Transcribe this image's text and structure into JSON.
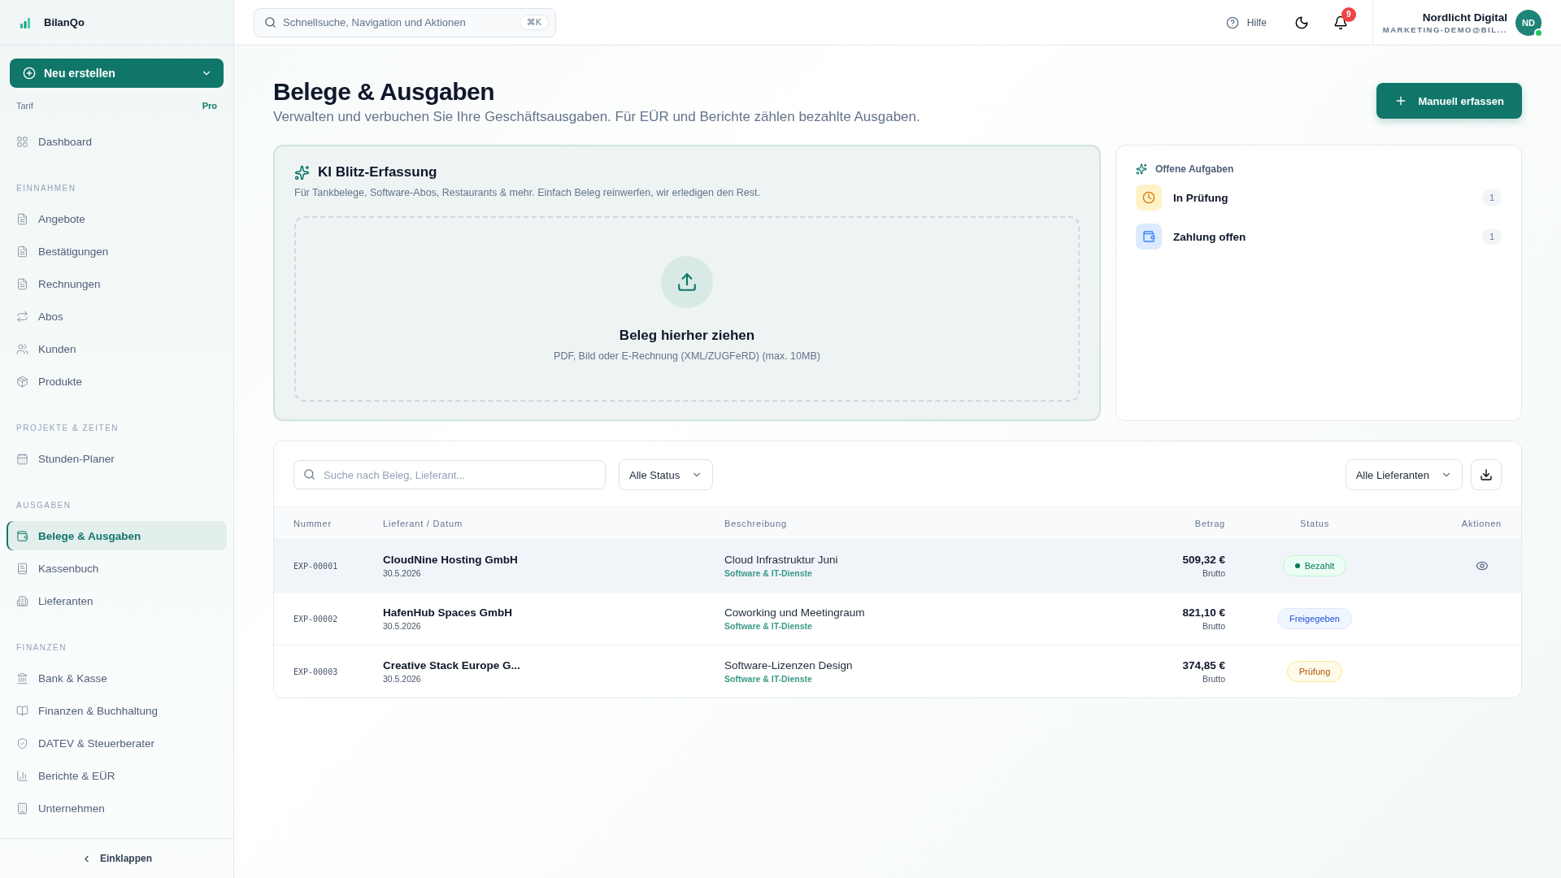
{
  "brand": {
    "name": "BilanQo"
  },
  "create_button": {
    "label": "Neu erstellen"
  },
  "plan": {
    "label": "Tarif",
    "value": "Pro"
  },
  "sidebar": {
    "groups": [
      {
        "items": [
          {
            "label": "Dashboard",
            "selected": false
          }
        ]
      },
      {
        "title": "EINNAHMEN",
        "items": [
          {
            "label": "Angebote",
            "selected": false
          },
          {
            "label": "Bestätigungen",
            "selected": false
          },
          {
            "label": "Rechnungen",
            "selected": false
          },
          {
            "label": "Abos",
            "selected": false
          },
          {
            "label": "Kunden",
            "selected": false
          },
          {
            "label": "Produkte",
            "selected": false
          }
        ]
      },
      {
        "title": "PROJEKTE & ZEITEN",
        "items": [
          {
            "label": "Stunden-Planer",
            "selected": false
          }
        ]
      },
      {
        "title": "AUSGABEN",
        "items": [
          {
            "label": "Belege & Ausgaben",
            "selected": true
          },
          {
            "label": "Kassenbuch",
            "selected": false
          },
          {
            "label": "Lieferanten",
            "selected": false
          }
        ]
      },
      {
        "title": "FINANZEN",
        "items": [
          {
            "label": "Bank & Kasse",
            "selected": false
          },
          {
            "label": "Finanzen & Buchhaltung",
            "selected": false
          },
          {
            "label": "DATEV & Steuerberater",
            "selected": false
          },
          {
            "label": "Berichte & EÜR",
            "selected": false
          },
          {
            "label": "Unternehmen",
            "selected": false
          }
        ]
      }
    ],
    "collapse": "Einklappen"
  },
  "topbar": {
    "search": {
      "placeholder": "Schnellsuche, Navigation und Aktionen",
      "shortcut": "⌘K"
    },
    "help": "Hilfe",
    "notifications": "9",
    "user": {
      "name": "Nordlicht Digital",
      "email": "MARKETING-DEMO@BIL...",
      "initials": "ND",
      "online": true
    }
  },
  "page": {
    "title": "Belege & Ausgaben",
    "subtitle": "Verwalten und verbuchen Sie Ihre Geschäftsausgaben. Für EÜR und Berichte zählen bezahlte Ausgaben.",
    "primary_button": "Manuell erfassen"
  },
  "ai_capture": {
    "title": "KI Blitz-Erfassung",
    "description": "Für Tankbelege, Software-Abos, Restaurants & mehr. Einfach Beleg reinwerfen, wir erledigen den Rest.",
    "dropzone": {
      "title": "Beleg hierher ziehen",
      "hint": "PDF, Bild oder E-Rechnung (XML/ZUGFeRD) (max. 10MB)"
    }
  },
  "tasks": {
    "title": "Offene Aufgaben",
    "items": [
      {
        "kind": "review",
        "label": "In Prüfung",
        "count": "1"
      },
      {
        "kind": "payment",
        "label": "Zahlung offen",
        "count": "1"
      }
    ]
  },
  "filters": {
    "search_placeholder": "Suche nach Beleg, Lieferant...",
    "status": "Alle Status",
    "supplier": "Alle Lieferanten"
  },
  "table": {
    "columns": [
      "Nummer",
      "Lieferant / Datum",
      "Beschreibung",
      "Betrag",
      "Status",
      "Aktionen"
    ],
    "rows": [
      {
        "number": "EXP-00001",
        "supplier": "CloudNine Hosting GmbH",
        "date": "30.5.2026",
        "description": "Cloud Infrastruktur Juni",
        "category": "Software & IT-Dienste",
        "amount": "509,32 €",
        "amount_note": "Brutto",
        "status": {
          "kind": "paid",
          "label": "Bezahlt"
        },
        "viewable": true,
        "selected": true
      },
      {
        "number": "EXP-00002",
        "supplier": "HafenHub Spaces GmbH",
        "date": "30.5.2026",
        "description": "Coworking und Meetingraum",
        "category": "Software & IT-Dienste",
        "amount": "821,10 €",
        "amount_note": "Brutto",
        "status": {
          "kind": "approved",
          "label": "Freigegeben"
        },
        "viewable": false,
        "selected": false
      },
      {
        "number": "EXP-00003",
        "supplier": "Creative Stack Europe G...",
        "date": "30.5.2026",
        "description": "Software-Lizenzen Design",
        "category": "Software & IT-Dienste",
        "amount": "374,85 €",
        "amount_note": "Brutto",
        "status": {
          "kind": "review",
          "label": "Prüfung"
        },
        "viewable": false,
        "selected": false
      }
    ]
  }
}
